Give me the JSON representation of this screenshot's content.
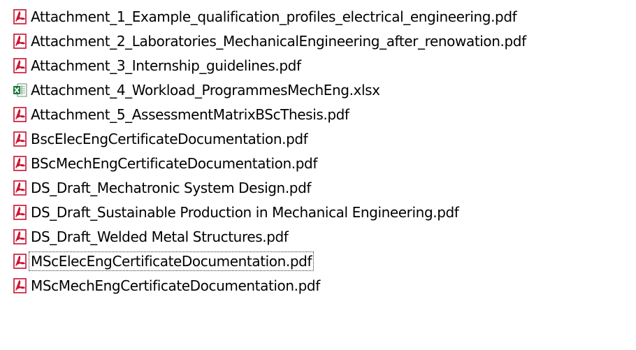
{
  "files": [
    {
      "name": "Attachment_1_Example_qualification_profiles_electrical_engineering.pdf",
      "icon": "pdf-icon",
      "focused": false
    },
    {
      "name": "Attachment_2_Laboratories_MechanicalEngineering_after_renowation.pdf",
      "icon": "pdf-icon",
      "focused": false
    },
    {
      "name": "Attachment_3_Internship_guidelines.pdf",
      "icon": "pdf-icon",
      "focused": false
    },
    {
      "name": "Attachment_4_Workload_ProgrammesMechEng.xlsx",
      "icon": "excel-icon",
      "focused": false
    },
    {
      "name": "Attachment_5_AssessmentMatrixBScThesis.pdf",
      "icon": "pdf-icon",
      "focused": false
    },
    {
      "name": "BscElecEngCertificateDocumentation.pdf",
      "icon": "pdf-icon",
      "focused": false
    },
    {
      "name": "BScMechEngCertificateDocumentation.pdf",
      "icon": "pdf-icon",
      "focused": false
    },
    {
      "name": "DS_Draft_Mechatronic System Design.pdf",
      "icon": "pdf-icon",
      "focused": false
    },
    {
      "name": "DS_Draft_Sustainable Production in Mechanical Engineering.pdf",
      "icon": "pdf-icon",
      "focused": false
    },
    {
      "name": "DS_Draft_Welded Metal Structures.pdf",
      "icon": "pdf-icon",
      "focused": false
    },
    {
      "name": "MScElecEngCertificateDocumentation.pdf",
      "icon": "pdf-icon",
      "focused": true
    },
    {
      "name": "MScMechEngCertificateDocumentation.pdf",
      "icon": "pdf-icon",
      "focused": false
    }
  ],
  "colors": {
    "pdf_icon": "#c8102e",
    "excel_icon": "#1d7a3a",
    "focus_border": "#333333"
  }
}
